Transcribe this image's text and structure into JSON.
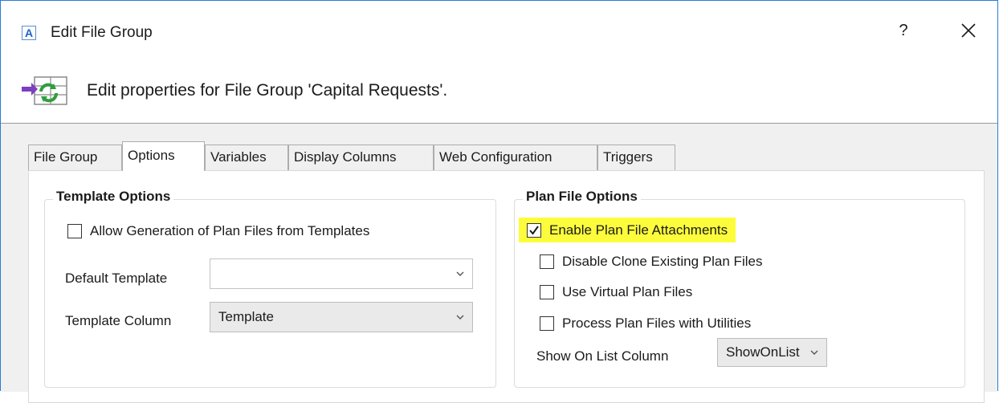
{
  "window": {
    "app_icon_letter": "A",
    "title": "Edit File Group",
    "help_label": "?"
  },
  "header": {
    "text": "Edit properties for File Group 'Capital Requests'."
  },
  "tabs": [
    {
      "label": "File Group",
      "active": false
    },
    {
      "label": "Options",
      "active": true
    },
    {
      "label": "Variables",
      "active": false
    },
    {
      "label": "Display Columns",
      "active": false
    },
    {
      "label": "Web Configuration",
      "active": false
    },
    {
      "label": "Triggers",
      "active": false
    }
  ],
  "template_options": {
    "title": "Template Options",
    "allow_generation": {
      "label": "Allow Generation of Plan Files from Templates",
      "checked": false
    },
    "default_template": {
      "label": "Default Template",
      "value": ""
    },
    "template_column": {
      "label": "Template Column",
      "value": "Template"
    }
  },
  "plan_file_options": {
    "title": "Plan File Options",
    "enable_attachments": {
      "label": "Enable Plan File Attachments",
      "checked": true,
      "highlight_color": "#fcfc3c"
    },
    "disable_clone": {
      "label": "Disable Clone Existing Plan Files",
      "checked": false
    },
    "use_virtual": {
      "label": "Use Virtual Plan Files",
      "checked": false
    },
    "process_utilities": {
      "label": "Process Plan Files with Utilities",
      "checked": false
    },
    "show_on_list": {
      "label": "Show On List Column",
      "value": "ShowOnList"
    }
  },
  "icons": {
    "app": "app-logo-icon",
    "header": "file-group-sync-icon",
    "close": "close-icon",
    "dropdown": "chevron-down-icon",
    "check": "checkmark-icon"
  }
}
